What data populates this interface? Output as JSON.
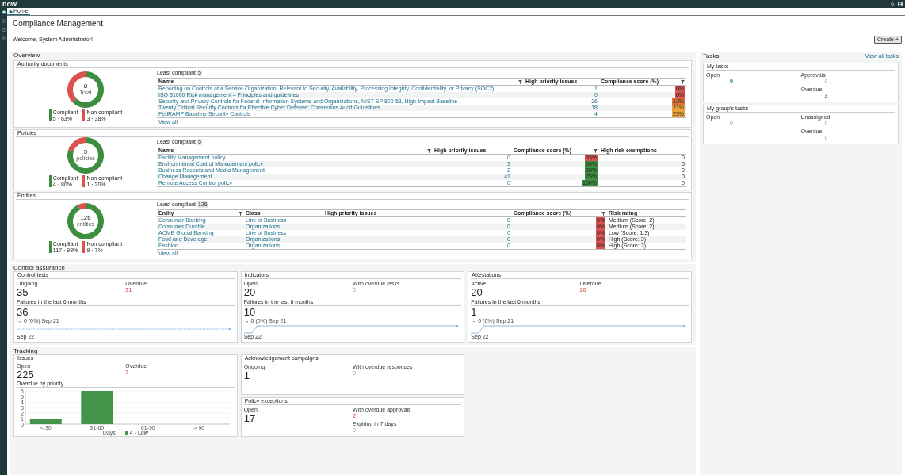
{
  "top_bar": {
    "logo": "now"
  },
  "tabs": [
    {
      "label": "Home",
      "selected": true
    }
  ],
  "title": "Compliance Management",
  "welcome": "Welcome, System Administrator!",
  "create_button": "Create +",
  "overview": {
    "title": "Overview",
    "cards": [
      {
        "title": "Authority documents",
        "donut": {
          "center_value": "8",
          "center_label": "Total",
          "chart_data": {
            "type": "donut",
            "values": [
              62.5,
              37.5
            ]
          },
          "legend": [
            {
              "label": "Compliant",
              "value": "5 · 63%",
              "color": "#3e8e41"
            },
            {
              "label": "Non compliant",
              "value": "3 · 38%",
              "color": "#d9534f"
            }
          ]
        },
        "table": {
          "heading": "Least compliant",
          "count": "5",
          "columns": [
            {
              "label": "Name",
              "filter": true
            },
            {
              "label": "High priority issues",
              "filter": false
            },
            {
              "label": "Compliance score (%)",
              "filter": true
            }
          ],
          "rows": [
            {
              "cells": [
                "Reporting on Controls at a Service Organization: Relevant to Security, Availability, Processing Integrity, Confidentiality, or Privacy (SOC2)",
                "1"
              ],
              "score": {
                "value": "0%",
                "color": "#d9534f"
              },
              "extra": []
            },
            {
              "cells": [
                "ISO 31000 Risk management – Principles and guidelines",
                "0"
              ],
              "score": {
                "value": "0%",
                "color": "#d9534f"
              },
              "extra": []
            },
            {
              "cells": [
                "Security and Privacy Controls for Federal Information Systems and Organizations, NIST SP 800-53, High-Impact Baseline",
                "26"
              ],
              "score": {
                "value": "13%",
                "color": "#e0703a"
              },
              "extra": []
            },
            {
              "cells": [
                "Twenty Critical Security Controls for Effective Cyber Defense: Consensus Audit Guidelines",
                "18"
              ],
              "score": {
                "value": "21%",
                "color": "#e8a33c"
              },
              "extra": []
            },
            {
              "cells": [
                "FedRAMP Baseline Security Controls",
                "4"
              ],
              "score": {
                "value": "25%",
                "color": "#e8a33c"
              },
              "extra": []
            }
          ],
          "view_all": "View all"
        }
      },
      {
        "title": "Policies",
        "donut": {
          "center_value": "5",
          "center_label": "policies",
          "chart_data": {
            "type": "donut",
            "values": [
              80,
              20
            ]
          },
          "legend": [
            {
              "label": "Compliant",
              "value": "4 · 80%",
              "color": "#3e8e41"
            },
            {
              "label": "Non compliant",
              "value": "1 · 20%",
              "color": "#d9534f"
            }
          ]
        },
        "table": {
          "heading": "Least compliant",
          "count": "5",
          "columns": [
            {
              "label": "Name",
              "filter": true
            },
            {
              "label": "High priority issues",
              "filter": false
            },
            {
              "label": "Compliance score (%)",
              "filter": true
            },
            {
              "label": "High risk exemptions",
              "filter": false
            }
          ],
          "rows": [
            {
              "cells": [
                "Facility Management policy",
                "0"
              ],
              "score": {
                "value": "33%",
                "color": "#d9534f"
              },
              "extra": [
                "0"
              ]
            },
            {
              "cells": [
                "Environmental Control Management policy",
                "3"
              ],
              "score": {
                "value": "60%",
                "color": "#3e8e41"
              },
              "extra": [
                "0"
              ]
            },
            {
              "cells": [
                "Business Records and Media Management",
                "2"
              ],
              "score": {
                "value": "80%",
                "color": "#3e8e41"
              },
              "extra": [
                "0"
              ]
            },
            {
              "cells": [
                "Change Management",
                "41"
              ],
              "score": {
                "value": "75%",
                "color": "#3e8e41"
              },
              "extra": [
                "0"
              ]
            },
            {
              "cells": [
                "Remote Access Control policy",
                "0"
              ],
              "score": {
                "value": "100%",
                "color": "#3e8e41"
              },
              "extra": [
                "0"
              ]
            }
          ]
        }
      },
      {
        "title": "Entities",
        "donut": {
          "center_value": "126",
          "center_label": "entities",
          "chart_data": {
            "type": "donut",
            "values": [
              92.9,
              7.1
            ]
          },
          "legend": [
            {
              "label": "Compliant",
              "value": "117 · 93%",
              "color": "#3e8e41"
            },
            {
              "label": "Non compliant",
              "value": "9 · 7%",
              "color": "#d9534f"
            }
          ]
        },
        "table": {
          "heading": "Least compliant",
          "count": "126",
          "columns": [
            {
              "label": "Entity",
              "filter": true
            },
            {
              "label": "Class",
              "filter": false
            },
            {
              "label": "High priority issues",
              "filter": false
            },
            {
              "label": "Compliance score (%)",
              "filter": true
            },
            {
              "label": "Risk rating",
              "filter": false
            }
          ],
          "rows": [
            {
              "cells": [
                "Consumer Banking",
                "Line of Business",
                "0"
              ],
              "score": {
                "value": "0%",
                "color": "#d9534f"
              },
              "extra": [
                "Medium (Score: 2)"
              ]
            },
            {
              "cells": [
                "Consumer Durable",
                "Organizations",
                "0"
              ],
              "score": {
                "value": "0%",
                "color": "#d9534f"
              },
              "extra": [
                "Medium (Score: 2)"
              ]
            },
            {
              "cells": [
                "ACME Global Banking",
                "Line of Business",
                "0"
              ],
              "score": {
                "value": "0%",
                "color": "#d9534f"
              },
              "extra": [
                "Low (Score: 1.3)"
              ]
            },
            {
              "cells": [
                "Food and Beverage",
                "Organizations",
                "0"
              ],
              "score": {
                "value": "0%",
                "color": "#d9534f"
              },
              "extra": [
                "High (Score: 3)"
              ]
            },
            {
              "cells": [
                "Fashion",
                "Organizations",
                "0"
              ],
              "score": {
                "value": "0%",
                "color": "#d9534f"
              },
              "extra": [
                "High (Score: 3)"
              ]
            }
          ],
          "view_all": "View all"
        }
      }
    ]
  },
  "control_assurance": {
    "title": "Control assurance",
    "cards": [
      {
        "title": "Control tests",
        "metrics": [
          {
            "label": "Ongoing",
            "value": "35",
            "kind": "large"
          },
          {
            "label": "Overdue",
            "value": "31",
            "kind": "alert"
          }
        ],
        "failures": {
          "label": "Failures in the last 6 months",
          "value": "36",
          "trend": "→ 0 (0%) Sep 21",
          "sparkline": {
            "kind": "flat"
          },
          "axis_label": "Sep 22"
        }
      },
      {
        "title": "Indicators",
        "metrics": [
          {
            "label": "Open",
            "value": "20",
            "kind": "large"
          },
          {
            "label": "With overdue tasks",
            "value": "0",
            "kind": "muted"
          }
        ],
        "failures": {
          "label": "Failures in the last 6 months",
          "value": "10",
          "trend": "→ 0 (0%) Sep 21",
          "sparkline": {
            "kind": "step"
          },
          "axis_label": "Sep 22"
        }
      },
      {
        "title": "Attestations",
        "metrics": [
          {
            "label": "Active",
            "value": "20",
            "kind": "large"
          },
          {
            "label": "Overdue",
            "value": "20",
            "kind": "alert"
          }
        ],
        "failures": {
          "label": "Failures in the last 6 months",
          "value": "1",
          "trend": "→ 0 (0%) Sep 21",
          "sparkline": {
            "kind": "step"
          },
          "axis_label": "Sep 22"
        }
      }
    ]
  },
  "tracking": {
    "title": "Tracking",
    "issues": {
      "title": "Issues",
      "metrics": [
        {
          "label": "Open",
          "value": "225",
          "kind": "large"
        },
        {
          "label": "Overdue",
          "value": "7",
          "kind": "alert"
        }
      ],
      "chart_title": "Overdue by priority",
      "chart_data": {
        "type": "bar",
        "categories": [
          "< 30",
          "31-60",
          "61-90",
          "> 90"
        ],
        "xlabel": "Days",
        "ylim": [
          0,
          6
        ],
        "yticks": [
          0,
          1,
          2,
          3,
          4,
          5,
          6
        ],
        "grid": true,
        "series": [
          {
            "name": "4 - Low",
            "color": "#43944a",
            "values": [
              1,
              6,
              0,
              0
            ]
          }
        ]
      }
    },
    "cards": [
      {
        "title": "Acknowledgement campaigns",
        "metrics": [
          {
            "label": "Ongoing",
            "value": "1",
            "kind": "large"
          },
          {
            "label": "With overdue responses",
            "value": "0",
            "kind": "muted"
          }
        ]
      },
      {
        "title": "Policy exceptions",
        "metrics": [
          {
            "label": "Open",
            "value": "17",
            "kind": "large"
          },
          {
            "label": "With overdue approvals",
            "value": "2",
            "kind": "alert"
          },
          {
            "label": "Expiring in 7 days",
            "value": "0",
            "kind": "muted"
          }
        ]
      }
    ]
  },
  "tasks": {
    "title": "Tasks",
    "view_all": "View all tasks",
    "groups": [
      {
        "title": "My tasks",
        "metrics": [
          {
            "label": "Open",
            "value": "9",
            "kind": "link"
          },
          {
            "label": "Approvals",
            "value": "0",
            "kind": "muted"
          },
          {
            "label": "Overdue",
            "value": "3",
            "kind": "link"
          }
        ]
      },
      {
        "title": "My group's tasks",
        "metrics": [
          {
            "label": "Open",
            "value": "0",
            "kind": "muted"
          },
          {
            "label": "Unassigned",
            "value": "0",
            "kind": "muted"
          },
          {
            "label": "Overdue",
            "value": "0",
            "kind": "muted"
          }
        ]
      }
    ]
  }
}
